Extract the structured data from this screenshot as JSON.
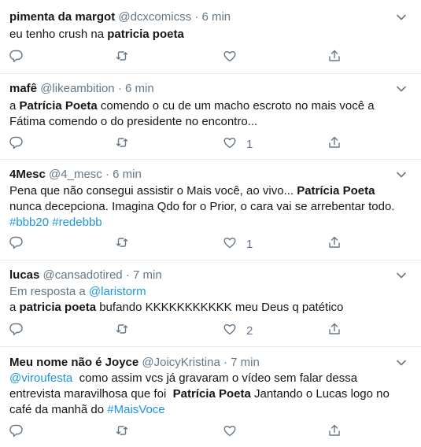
{
  "tweets": [
    {
      "display_name": "pimenta da margot",
      "handle": "@dcxcomicss",
      "sep": "·",
      "time": "6 min",
      "lines": [
        [
          "eu tenho crush na ",
          "patricia poeta",
          ""
        ]
      ],
      "like_count": ""
    },
    {
      "display_name": "mafê",
      "handle": "@likeambition",
      "sep": "·",
      "time": "6 min",
      "lines": [
        [
          "a ",
          "Patrícia Poeta",
          " comendo o cu de um macho escroto no mais você a"
        ],
        [
          "Fátima comendo o do presidente no encontro...",
          "",
          ""
        ]
      ],
      "like_count": "1"
    },
    {
      "display_name": "4Mesc",
      "handle": "@4_mesc",
      "sep": "·",
      "time": "6 min",
      "lines": [
        [
          "Pena que não consegui assistir o Mais você, ao vivo... ",
          "Patrícia Poeta",
          ""
        ],
        [
          " nunca decepciona. Imagina Qdo for o Prior, o cara vai se arrebentar todo.",
          "",
          ""
        ]
      ],
      "hashtags": [
        "#bbb20",
        "#redebbb"
      ],
      "like_count": "1"
    },
    {
      "display_name": "lucas",
      "handle": "@cansadotired",
      "sep": "·",
      "time": "7 min",
      "reply_prefix": "Em resposta a ",
      "reply_handle": "@laristorm",
      "lines": [
        [
          "a ",
          "patricia poeta",
          " bufando KKKKKKKKKKK meu Deus q patético"
        ]
      ],
      "like_count": "2"
    },
    {
      "display_name": "Meu nome não é Joyce",
      "handle": "@JoicyKristina",
      "sep": "·",
      "time": "7 min",
      "mention": "@viroufesta",
      "line1_rest": "  como assim vcs já gravaram o vídeo sem falar dessa",
      "line2_pre": "entrevista maravilhosa que foi  ",
      "line2_bold": "Patrícia Poeta",
      "line2_post": " Jantando o Lucas logo no",
      "line3_pre": "café da manhã do ",
      "line3_tag": "#MaisVoce",
      "like_count": ""
    }
  ],
  "icons": {
    "reply": "reply-icon",
    "retweet": "retweet-icon",
    "like": "heart-icon",
    "share": "share-icon",
    "caret": "chevron-down-icon"
  },
  "colors": {
    "text": "#14171a",
    "secondary": "#657786",
    "link": "#1b95e0",
    "divider": "#e6ecf0"
  }
}
